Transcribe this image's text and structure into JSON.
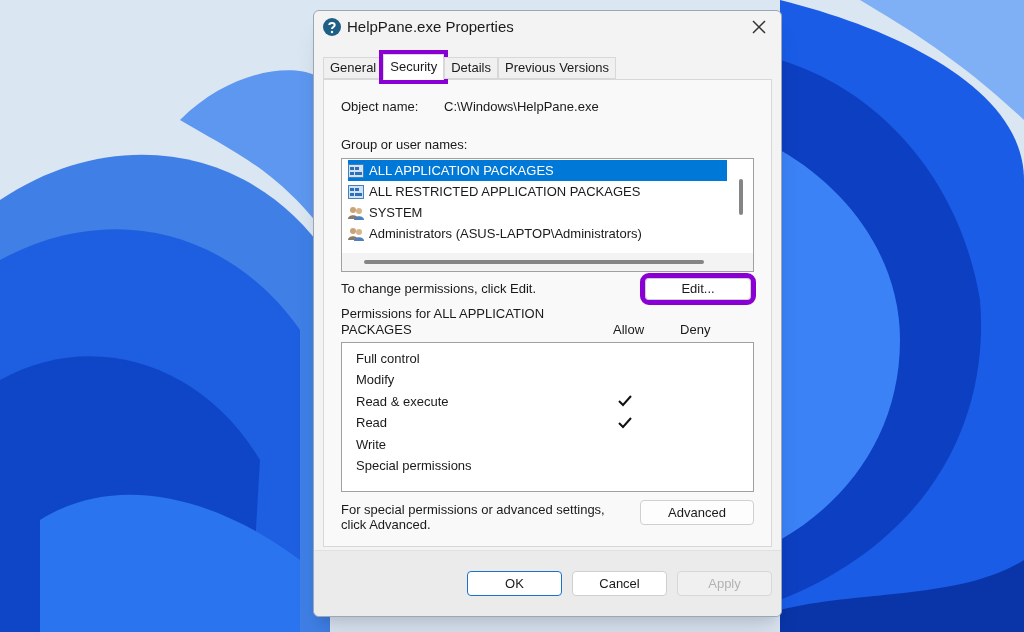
{
  "window": {
    "title": "HelpPane.exe Properties"
  },
  "tabs": [
    {
      "label": "General",
      "selected": false,
      "highlighted": false
    },
    {
      "label": "Security",
      "selected": true,
      "highlighted": true
    },
    {
      "label": "Details",
      "selected": false,
      "highlighted": false
    },
    {
      "label": "Previous Versions",
      "selected": false,
      "highlighted": false
    }
  ],
  "object_name": {
    "label": "Object name:",
    "value": "C:\\Windows\\HelpPane.exe"
  },
  "groups": {
    "label": "Group or user names:",
    "items": [
      {
        "name": "ALL APPLICATION PACKAGES",
        "kind": "package",
        "selected": true
      },
      {
        "name": "ALL RESTRICTED APPLICATION PACKAGES",
        "kind": "package",
        "selected": false
      },
      {
        "name": "SYSTEM",
        "kind": "users",
        "selected": false
      },
      {
        "name": "Administrators (ASUS-LAPTOP\\Administrators)",
        "kind": "users",
        "selected": false
      }
    ]
  },
  "edit_hint": "To change permissions, click Edit.",
  "edit_button": {
    "label": "Edit...",
    "highlighted": true
  },
  "permissions": {
    "title": "Permissions for ALL APPLICATION PACKAGES",
    "allow_header": "Allow",
    "deny_header": "Deny",
    "rows": [
      {
        "name": "Full control",
        "allow": false,
        "deny": false
      },
      {
        "name": "Modify",
        "allow": false,
        "deny": false
      },
      {
        "name": "Read & execute",
        "allow": true,
        "deny": false
      },
      {
        "name": "Read",
        "allow": true,
        "deny": false
      },
      {
        "name": "Write",
        "allow": false,
        "deny": false
      },
      {
        "name": "Special permissions",
        "allow": false,
        "deny": false
      }
    ]
  },
  "advanced_hint": "For special permissions or advanced settings, click Advanced.",
  "advanced_button": {
    "label": "Advanced"
  },
  "buttons": [
    {
      "label": "OK",
      "kind": "default",
      "disabled": false
    },
    {
      "label": "Cancel",
      "kind": "normal",
      "disabled": false
    },
    {
      "label": "Apply",
      "kind": "normal",
      "disabled": true
    }
  ]
}
